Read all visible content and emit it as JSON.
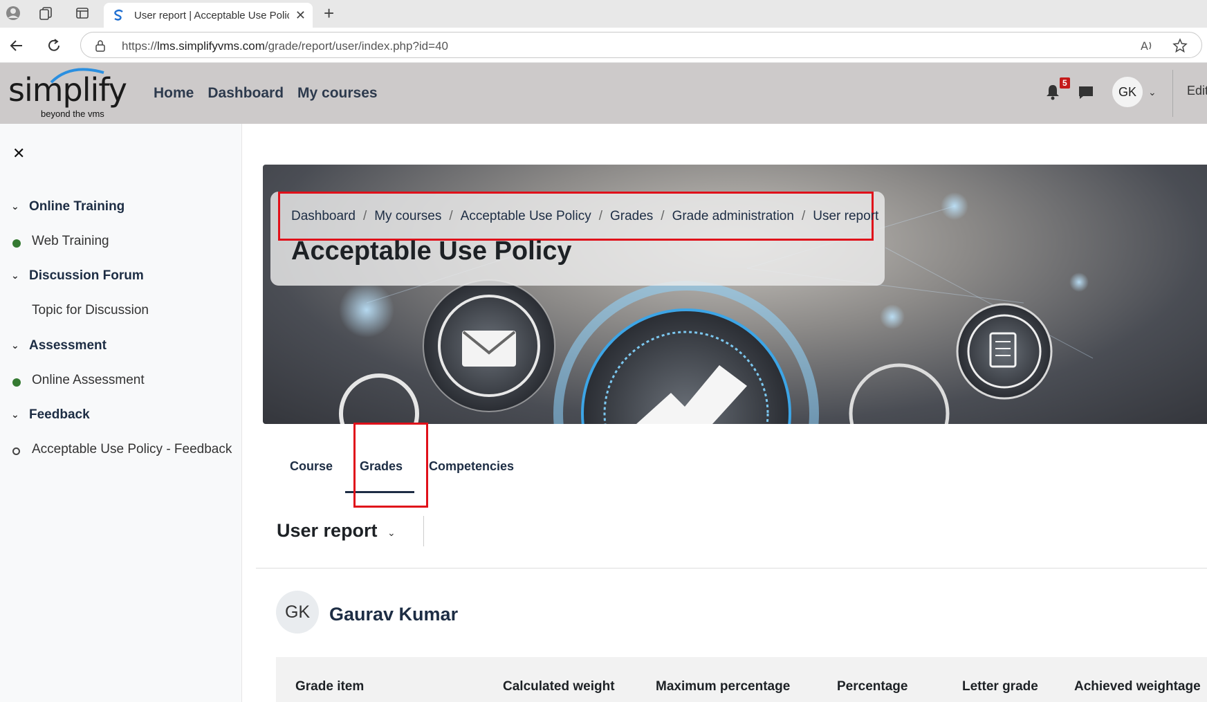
{
  "browser": {
    "tab_title": "User report | Acceptable Use Polic",
    "url_prefix": "https://",
    "url_host": "lms.simplifyvms.com",
    "url_path": "/grade/report/user/index.php?id=40"
  },
  "header": {
    "logo_word": "simplify",
    "logo_tagline": "beyond the vms",
    "nav": [
      "Home",
      "Dashboard",
      "My courses"
    ],
    "notification_count": "5",
    "user_initials": "GK",
    "edit_label": "Edit"
  },
  "sidebar": {
    "sections": [
      {
        "label": "Online Training"
      },
      {
        "label": "Discussion Forum"
      },
      {
        "label": "Assessment"
      },
      {
        "label": "Feedback"
      }
    ],
    "activities": [
      {
        "label": "Web Training"
      },
      {
        "label": "Topic for Discussion"
      },
      {
        "label": "Online Assessment"
      },
      {
        "label": "Acceptable Use Policy - Feedback"
      }
    ]
  },
  "breadcrumb": [
    "Dashboard",
    "My courses",
    "Acceptable Use Policy",
    "Grades",
    "Grade administration",
    "User report"
  ],
  "page_title": "Acceptable Use Policy",
  "tabs": [
    "Course",
    "Grades",
    "Competencies"
  ],
  "report_selector": "User report",
  "user": {
    "initials": "GK",
    "name": "Gaurav Kumar"
  },
  "grade_table": {
    "columns": [
      "Grade item",
      "Calculated weight",
      "Maximum percentage",
      "Percentage",
      "Letter grade",
      "Achieved weightage"
    ]
  },
  "colors": {
    "highlight": "#e0101a",
    "completed_dot": "#357a32",
    "header_bg": "#cdcaca",
    "badge": "#c41a1a"
  }
}
